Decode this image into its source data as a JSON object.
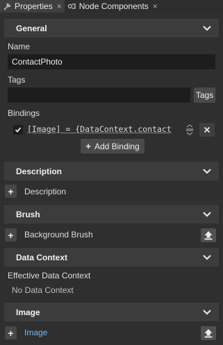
{
  "tabs": [
    {
      "label": "Properties",
      "icon": "wrench-icon",
      "active": true
    },
    {
      "label": "Node Components",
      "icon": "component-icon",
      "active": false
    }
  ],
  "general": {
    "title": "General",
    "name_label": "Name",
    "name_value": "ContactPhoto",
    "tags_label": "Tags",
    "tags_value": "",
    "tags_button": "Tags",
    "bindings_label": "Bindings",
    "binding_expression": "[Image] = {DataContext.contact",
    "binding_checked": true,
    "add_binding_label": "Add Binding"
  },
  "description": {
    "title": "Description",
    "row_label": "Description"
  },
  "brush": {
    "title": "Brush",
    "row_label": "Background Brush"
  },
  "data_context": {
    "title": "Data Context",
    "effective_label": "Effective Data Context",
    "effective_value": "No Data Context"
  },
  "image": {
    "title": "Image",
    "row_label": "Image"
  },
  "colors": {
    "panel_bg": "#2f2f2f",
    "section_header_bg": "#3c3c3c",
    "field_bg": "#1d1d1d",
    "link": "#6fb7f0"
  }
}
